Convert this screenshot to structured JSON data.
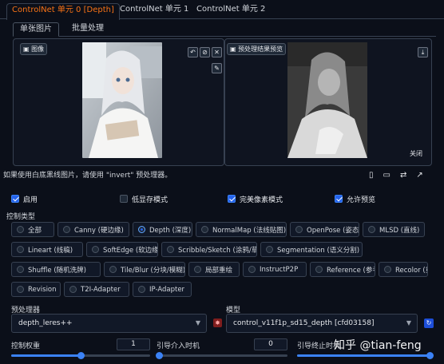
{
  "tabs": [
    "ControlNet 单元 0 [Depth]",
    "ControlNet 单元 1",
    "ControlNet 单元 2"
  ],
  "subtabs": [
    "单张图片",
    "批量处理"
  ],
  "image_panel": {
    "label": "图像"
  },
  "result_panel": {
    "label": "预处理结果预览",
    "close_label": "关闭"
  },
  "hint": "如果使用白底黑线图片，请使用 \"invert\" 预处理器。",
  "checkboxes": [
    {
      "label": "启用",
      "checked": true
    },
    {
      "label": "低显存模式",
      "checked": false
    },
    {
      "label": "完美像素模式",
      "checked": true
    },
    {
      "label": "允许预览",
      "checked": true
    }
  ],
  "control_type": {
    "label": "控制类型",
    "options": [
      "全部",
      "Canny (硬边缘)",
      "Depth (深度)",
      "NormalMap (法线贴图)",
      "OpenPose (姿态)",
      "MLSD (直线)",
      "Lineart (线稿)",
      "SoftEdge (软边缘)",
      "Scribble/Sketch (涂鸦/草图)",
      "Segmentation (语义分割)",
      "Shuffle (随机洗牌)",
      "Tile/Blur (分块/模糊)",
      "局部重绘",
      "InstructP2P",
      "Reference (参考)",
      "Recolor (重上色)",
      "Revision",
      "T2I-Adapter",
      "IP-Adapter"
    ],
    "selected": "Depth (深度)"
  },
  "preprocessor": {
    "label": "预处理器",
    "value": "depth_leres++"
  },
  "model": {
    "label": "模型",
    "value": "control_v11f1p_sd15_depth [cfd03158]"
  },
  "sliders": [
    {
      "label": "控制权重",
      "value": "1",
      "fraction": 0.5
    },
    {
      "label": "引导介入时机",
      "value": "0",
      "fraction": 0.0
    },
    {
      "label": "引导终止时机",
      "value": "1",
      "fraction": 1.0
    }
  ],
  "watermark": "知乎 @tian-feng",
  "colors": {
    "accent": "#f97316",
    "primary": "#2563eb",
    "background": "#0b0f19"
  }
}
